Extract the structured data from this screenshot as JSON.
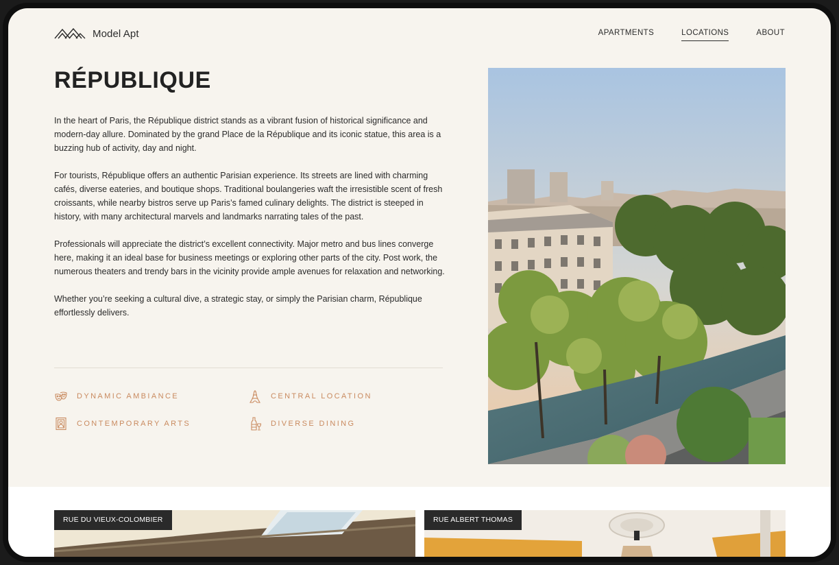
{
  "brand": {
    "name": "Model Apt"
  },
  "nav": {
    "items": [
      {
        "label": "APARTMENTS"
      },
      {
        "label": "LOCATIONS"
      },
      {
        "label": "ABOUT"
      }
    ],
    "active": "LOCATIONS"
  },
  "page": {
    "title": "RÉPUBLIQUE",
    "paragraphs": [
      "In the heart of Paris, the République district stands as a vibrant fusion of historical significance and modern-day allure. Dominated by the grand Place de la République and its iconic statue, this area is a buzzing hub of activity, day and night.",
      "For tourists, République offers an authentic Parisian experience. Its streets are lined with charming cafés, diverse eateries, and boutique shops. Traditional boulangeries waft the irresistible scent of fresh croissants, while nearby bistros serve up Paris’s famed culinary delights. The district is steeped in history, with many architectural marvels and landmarks narrating tales of the past.",
      "Professionals will appreciate the district’s excellent connectivity. Major metro and bus lines converge here, making it an ideal base for business meetings or exploring other parts of the city. Post work, the numerous theaters and trendy bars in the vicinity provide ample avenues for relaxation and networking.",
      "Whether you’re seeking a cultural dive, a strategic stay, or simply the Parisian charm, République effortlessly delivers."
    ]
  },
  "features": [
    {
      "label": "DYNAMIC AMBIANCE",
      "icon": "masks-icon"
    },
    {
      "label": "CENTRAL LOCATION",
      "icon": "eiffel-tower-icon"
    },
    {
      "label": "CONTEMPORARY ARTS",
      "icon": "portrait-frame-icon"
    },
    {
      "label": "DIVERSE DINING",
      "icon": "wine-bottle-icon"
    }
  ],
  "listings": [
    {
      "label": "RUE DU VIEUX-COLOMBIER"
    },
    {
      "label": "RUE ALBERT THOMAS"
    }
  ],
  "colors": {
    "background": "#f7f4ee",
    "accent": "#c98a5f",
    "text": "#2a2a2a",
    "tag_bg": "#2a2a2a"
  }
}
